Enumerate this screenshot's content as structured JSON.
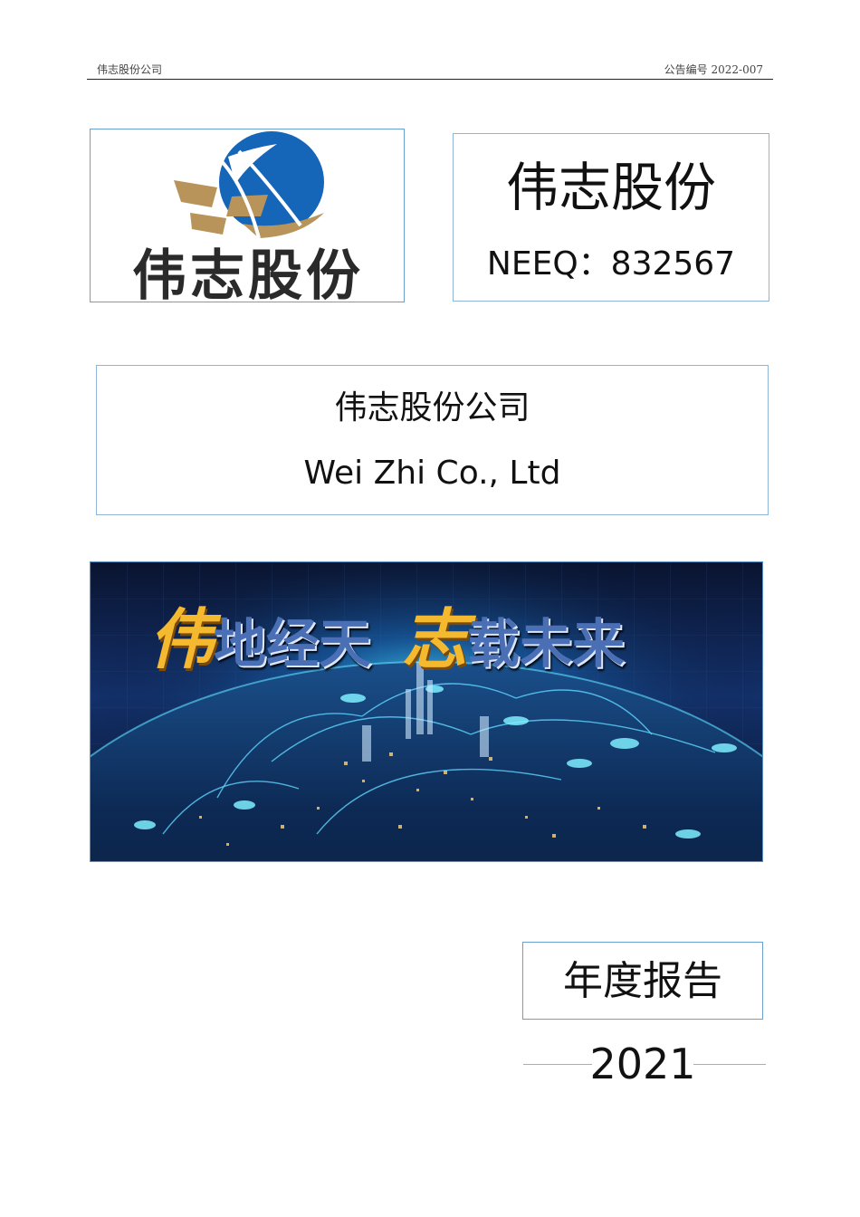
{
  "header": {
    "company": "伟志股份公司",
    "notice_number": "公告编号 2022-007"
  },
  "logo": {
    "text": "伟志股份",
    "colors": {
      "blue": "#1565b8",
      "gold": "#b8935a"
    }
  },
  "title_box": {
    "company_short": "伟志股份",
    "stock_code": "NEEQ：832567"
  },
  "name_box": {
    "name_cn": "伟志股份公司",
    "name_en": "Wei Zhi Co., Ltd"
  },
  "banner": {
    "slogan_part1_lead": "伟",
    "slogan_part1_rest": "地经天",
    "slogan_part2_lead": "志",
    "slogan_part2_rest": "载未来",
    "colors": {
      "gold": "#f4b92e",
      "slogan": "#4a6fb4",
      "sky": "#0b1a3f",
      "glow": "#2fd3ff"
    }
  },
  "report": {
    "label": "年度报告",
    "year": "2021"
  }
}
